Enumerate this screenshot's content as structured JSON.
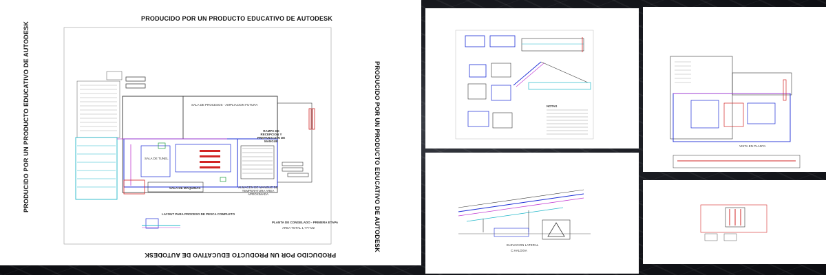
{
  "main_sheet": {
    "watermark": "PRODUCIDO POR UN PRODUCTO EDUCATIVO DE AUTODESK",
    "watermark_left": "PRODUCIDO POR UN PRODUCTO EDUCATIVO DE AUTODESK",
    "watermark_right": "PRODUCIDO POR UN PRODUCTO EDUCATIVO DE AUTODESK",
    "watermark_bottom": "PRODUCIDO POR UN PRODUCTO EDUCATIVO DE AUTODESK",
    "layout_caption": "LAYOUT PARA PROCESO DE PESCA COMPLETO",
    "title_block_line1": "PLANTA DE CONGELADO - PRIMERA ETAPA",
    "title_block_line2": "AREA TOTAL 1,??? M2",
    "room_maquinas": "SALA DE MAQUINAS",
    "room_future": "SALA DE PROCESOS - AMPLIACION FUTURA",
    "room_recepcion": "RAMPA DE RECEPCION Y PREPARACION DE MANGUE",
    "room_tunnel": "SALA DE TUNEL",
    "room_almacen": "ALMACEN DE MANGUE DE TEMPERATURA AREA APROXIMADA"
  },
  "side_sheet_1": {
    "notes_label": "NOTAS"
  },
  "side_sheet_2": {
    "label": "ELEVACION LATERAL",
    "sublabel": "C.HALDIXA"
  },
  "side_sheet_3": {
    "label": "VISTA EN PLANTA"
  },
  "colors": {
    "background": "#1c1e24",
    "sheet": "#ffffff",
    "blue_lines": "#1a2bd6",
    "cyan_lines": "#1fb7c9",
    "magenta_lines": "#c23bd1",
    "red_lines": "#d22424"
  }
}
